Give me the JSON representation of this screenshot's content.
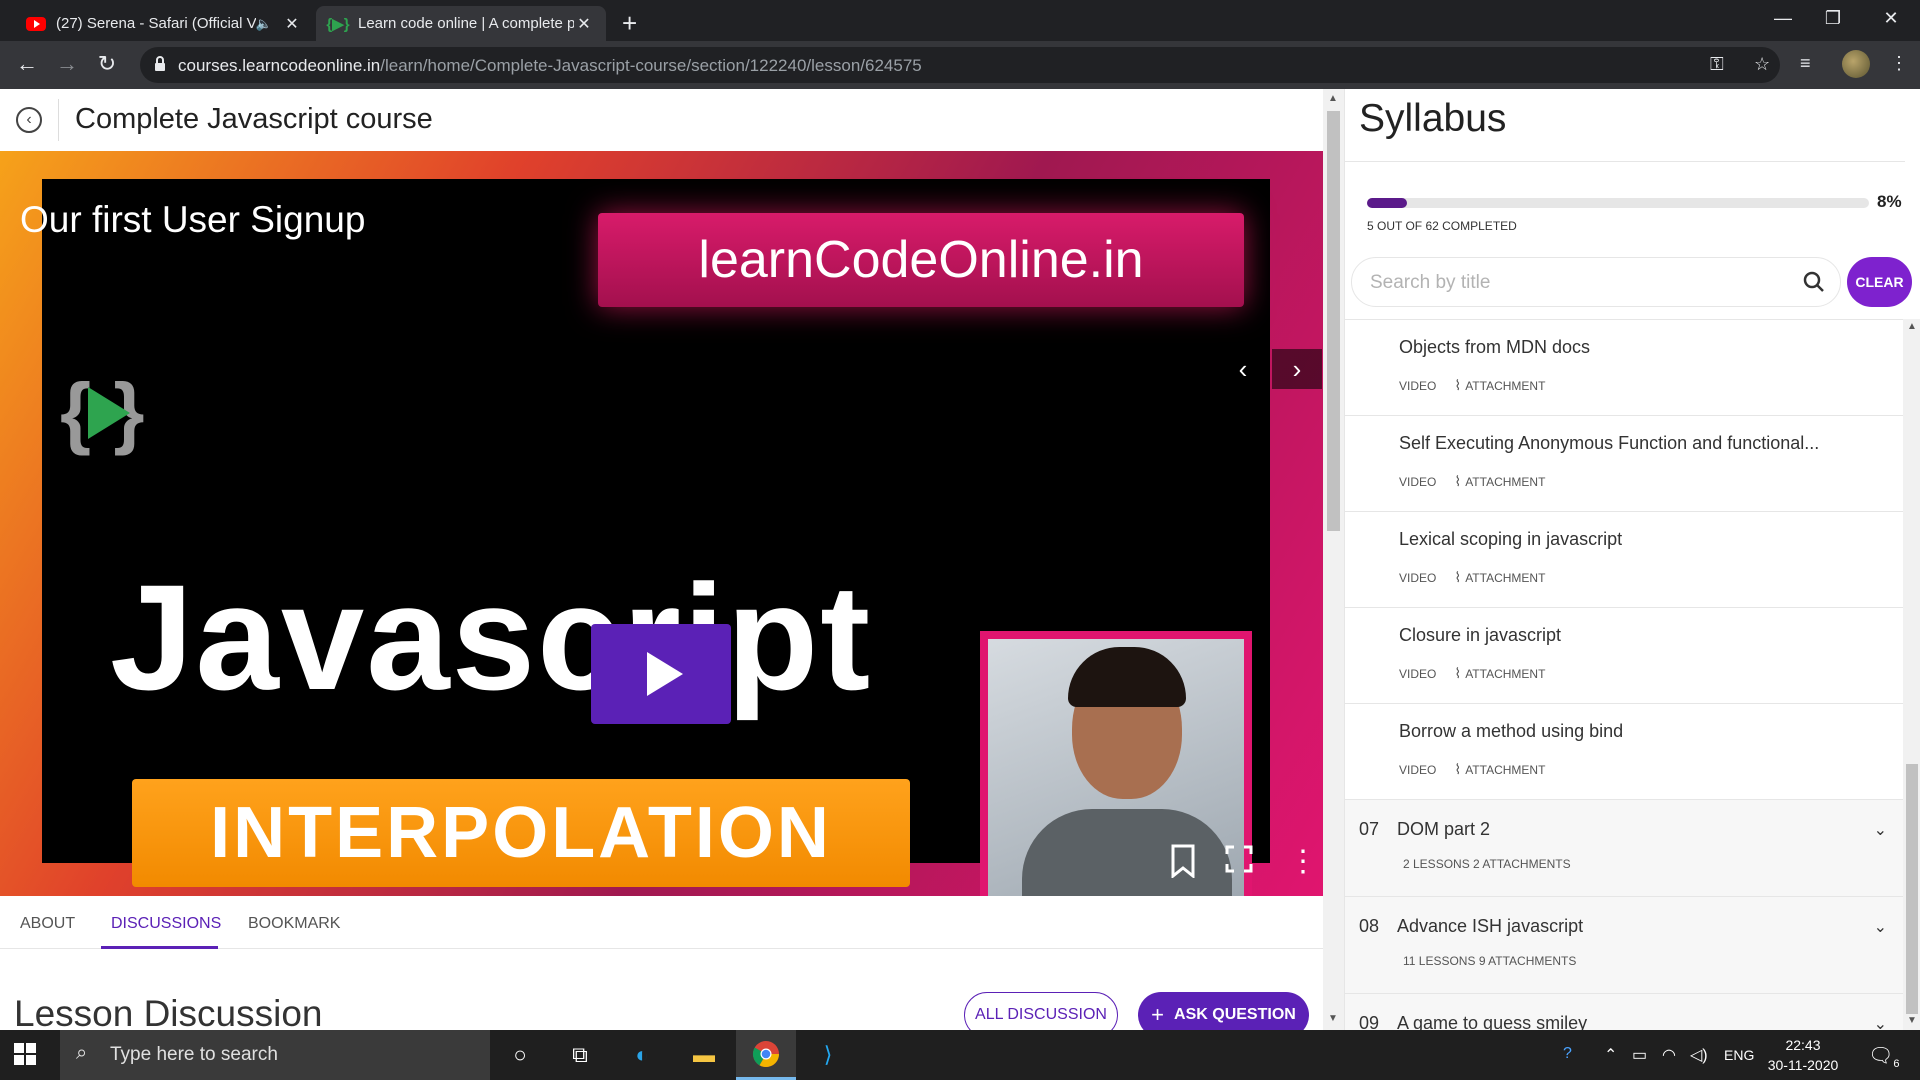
{
  "browser": {
    "tabs": [
      {
        "title": "(27) Serena - Safari (Official V",
        "close": "✕"
      },
      {
        "title": "Learn code online | A complete p",
        "close": "✕"
      }
    ],
    "new_tab": "+",
    "url_host": "courses.learncodeonline.in",
    "url_path": "/learn/home/Complete-Javascript-course/section/122240/lesson/624575"
  },
  "course": {
    "title": "Complete Javascript course",
    "lesson_title": "Our first User Signup",
    "thumbnail": {
      "logo_text": "learnCodeOnline.in",
      "big_text": "Javascript",
      "banner_text": "INTERPOLATION"
    },
    "tabs": [
      {
        "label": "ABOUT"
      },
      {
        "label": "DISCUSSIONS"
      },
      {
        "label": "BOOKMARK"
      }
    ],
    "active_tab": "DISCUSSIONS",
    "discussion_heading": "Lesson Discussion",
    "all_discussion_label": "ALL DISCUSSION",
    "ask_question_label": "ASK QUESTION"
  },
  "syllabus": {
    "title": "Syllabus",
    "progress_percent": 8,
    "progress_label": "8%",
    "completed_text": "5 OUT OF 62  COMPLETED",
    "search_placeholder": "Search by title",
    "clear_label": "CLEAR",
    "lessons": [
      {
        "title": "Objects from MDN docs",
        "type": "VIDEO",
        "attachment": "ATTACHMENT"
      },
      {
        "title": "Self Executing Anonymous Function and functional...",
        "type": "VIDEO",
        "attachment": "ATTACHMENT"
      },
      {
        "title": "Lexical scoping in javascript",
        "type": "VIDEO",
        "attachment": "ATTACHMENT"
      },
      {
        "title": "Closure in javascript",
        "type": "VIDEO",
        "attachment": "ATTACHMENT"
      },
      {
        "title": "Borrow a method using bind",
        "type": "VIDEO",
        "attachment": "ATTACHMENT"
      }
    ],
    "sections": [
      {
        "num": "07",
        "title": "DOM part 2",
        "meta": "2 LESSONS   2 ATTACHMENTS"
      },
      {
        "num": "08",
        "title": "Advance ISH javascript",
        "meta": "11 LESSONS   9 ATTACHMENTS"
      },
      {
        "num": "09",
        "title": "A game to guess smiley",
        "meta": ""
      }
    ]
  },
  "taskbar": {
    "search_placeholder": "Type here to search",
    "language": "ENG",
    "time": "22:43",
    "date": "30-11-2020",
    "notification_count": "6"
  },
  "colors": {
    "accent": "#5b21b6",
    "clear_button": "#7e22ce",
    "progress": "#5b1a8a"
  }
}
